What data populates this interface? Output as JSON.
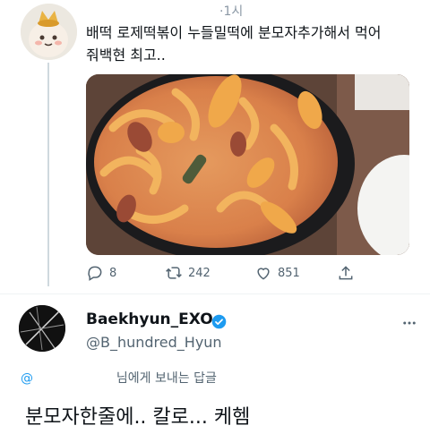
{
  "tweet1": {
    "time": "·1시",
    "text_line1": "배떡 로제떡볶이 누들밀떡에 분모자추가해서 먹어",
    "text_line2": "줘백현 최고..",
    "actions": {
      "replies": "8",
      "retweets": "242",
      "likes": "851"
    }
  },
  "tweet2": {
    "display_name": "Baekhyun_EXO",
    "handle": "@B_hundred_Hyun",
    "replying_to_at": "@",
    "replying_to_suffix": "님에게 보내는 답글",
    "text": "분모자한줄에.. 칼로... 케헴"
  },
  "colors": {
    "accent": "#1d9bf0",
    "secondary_text": "#536471",
    "divider": "#eff3f4"
  }
}
